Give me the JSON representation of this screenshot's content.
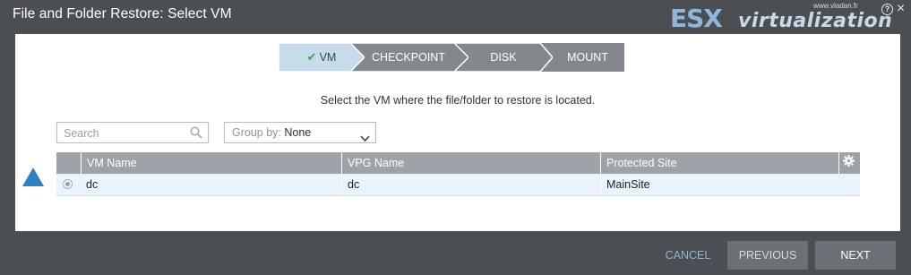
{
  "dialog": {
    "title": "File and Folder Restore: Select VM",
    "help_icon": "question-circle-icon",
    "close_icon": "close-icon"
  },
  "brand": {
    "prefix": "ESX",
    "suffix": "virtualization",
    "site": "www.vladan.fr"
  },
  "wizard": {
    "steps": [
      {
        "label": "VM",
        "state": "active",
        "icon": "check-icon"
      },
      {
        "label": "CHECKPOINT",
        "state": "inactive"
      },
      {
        "label": "DISK",
        "state": "inactive"
      },
      {
        "label": "MOUNT",
        "state": "inactive"
      }
    ],
    "active_color": "#c7dcea",
    "inactive_color": "#84888d"
  },
  "instruction": "Select the VM where the file/folder to restore is located.",
  "search": {
    "placeholder": "Search",
    "value": ""
  },
  "group_by": {
    "label": "Group by:",
    "value": "None"
  },
  "table": {
    "columns": [
      "",
      "VM Name",
      "VPG Name",
      "Protected Site"
    ],
    "settings_icon": "gear-icon",
    "rows": [
      {
        "selected": false,
        "vm_name": "dc",
        "vpg_name": "dc",
        "protected_site": "MainSite"
      }
    ]
  },
  "footer": {
    "cancel": "CANCEL",
    "previous": "PREVIOUS",
    "next": "NEXT"
  },
  "colors": {
    "background": "#4b4e53",
    "accent": "#2f80c0",
    "header": "#9ea3a9",
    "row_highlight": "#e9f3fb"
  }
}
